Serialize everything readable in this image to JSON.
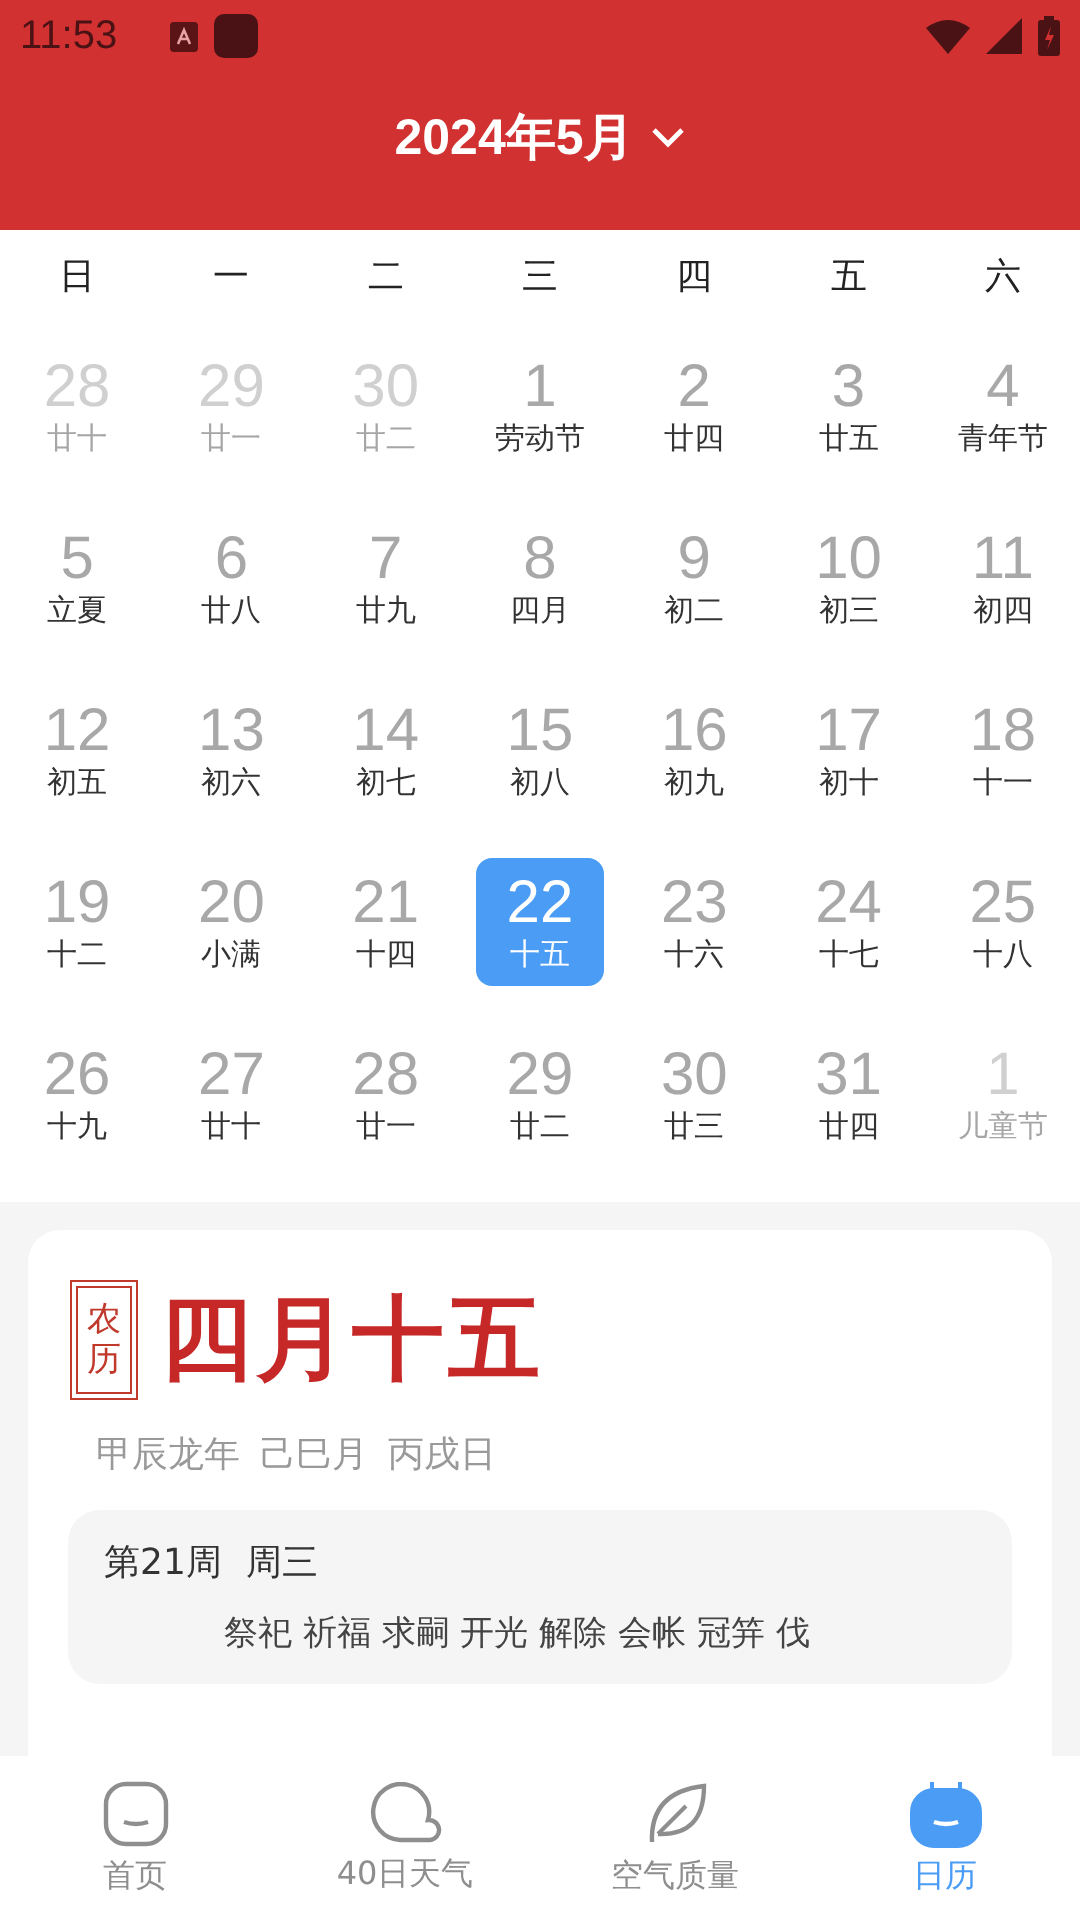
{
  "status_bar": {
    "time": "11:53"
  },
  "header": {
    "title": "2024年5月"
  },
  "weekdays": [
    "日",
    "一",
    "二",
    "三",
    "四",
    "五",
    "六"
  ],
  "days": [
    {
      "day": "28",
      "label": "廿十",
      "other_month": true,
      "selected": false
    },
    {
      "day": "29",
      "label": "廿一",
      "other_month": true,
      "selected": false
    },
    {
      "day": "30",
      "label": "廿二",
      "other_month": true,
      "selected": false
    },
    {
      "day": "1",
      "label": "劳动节",
      "other_month": false,
      "selected": false
    },
    {
      "day": "2",
      "label": "廿四",
      "other_month": false,
      "selected": false
    },
    {
      "day": "3",
      "label": "廿五",
      "other_month": false,
      "selected": false
    },
    {
      "day": "4",
      "label": "青年节",
      "other_month": false,
      "selected": false
    },
    {
      "day": "5",
      "label": "立夏",
      "other_month": false,
      "selected": false
    },
    {
      "day": "6",
      "label": "廿八",
      "other_month": false,
      "selected": false
    },
    {
      "day": "7",
      "label": "廿九",
      "other_month": false,
      "selected": false
    },
    {
      "day": "8",
      "label": "四月",
      "other_month": false,
      "selected": false
    },
    {
      "day": "9",
      "label": "初二",
      "other_month": false,
      "selected": false
    },
    {
      "day": "10",
      "label": "初三",
      "other_month": false,
      "selected": false
    },
    {
      "day": "11",
      "label": "初四",
      "other_month": false,
      "selected": false
    },
    {
      "day": "12",
      "label": "初五",
      "other_month": false,
      "selected": false
    },
    {
      "day": "13",
      "label": "初六",
      "other_month": false,
      "selected": false
    },
    {
      "day": "14",
      "label": "初七",
      "other_month": false,
      "selected": false
    },
    {
      "day": "15",
      "label": "初八",
      "other_month": false,
      "selected": false
    },
    {
      "day": "16",
      "label": "初九",
      "other_month": false,
      "selected": false
    },
    {
      "day": "17",
      "label": "初十",
      "other_month": false,
      "selected": false
    },
    {
      "day": "18",
      "label": "十一",
      "other_month": false,
      "selected": false
    },
    {
      "day": "19",
      "label": "十二",
      "other_month": false,
      "selected": false
    },
    {
      "day": "20",
      "label": "小满",
      "other_month": false,
      "selected": false
    },
    {
      "day": "21",
      "label": "十四",
      "other_month": false,
      "selected": false
    },
    {
      "day": "22",
      "label": "十五",
      "other_month": false,
      "selected": true
    },
    {
      "day": "23",
      "label": "十六",
      "other_month": false,
      "selected": false
    },
    {
      "day": "24",
      "label": "十七",
      "other_month": false,
      "selected": false
    },
    {
      "day": "25",
      "label": "十八",
      "other_month": false,
      "selected": false
    },
    {
      "day": "26",
      "label": "十九",
      "other_month": false,
      "selected": false
    },
    {
      "day": "27",
      "label": "廿十",
      "other_month": false,
      "selected": false
    },
    {
      "day": "28",
      "label": "廿一",
      "other_month": false,
      "selected": false
    },
    {
      "day": "29",
      "label": "廿二",
      "other_month": false,
      "selected": false
    },
    {
      "day": "30",
      "label": "廿三",
      "other_month": false,
      "selected": false
    },
    {
      "day": "31",
      "label": "廿四",
      "other_month": false,
      "selected": false
    },
    {
      "day": "1",
      "label": "儿童节",
      "other_month": true,
      "selected": false
    }
  ],
  "lunar_card": {
    "badge": "农历",
    "lunar_date": "四月十五",
    "ganzhi": [
      "甲辰龙年",
      "己巳月",
      "丙戌日"
    ],
    "week": "第21周",
    "weekday": "周三",
    "activities": "祭祀 祈福 求嗣 开光 解除 会帐 冠笄 伐"
  },
  "bottom_nav": [
    {
      "label": "首页",
      "kind": "home",
      "selected": false
    },
    {
      "label": "40日天气",
      "kind": "cloud",
      "selected": false
    },
    {
      "label": "空气质量",
      "kind": "leaf",
      "selected": false
    },
    {
      "label": "日历",
      "kind": "calendar",
      "selected": true
    }
  ]
}
